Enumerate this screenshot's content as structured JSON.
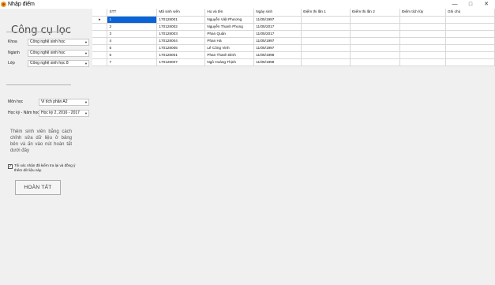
{
  "window": {
    "title": "Nhập điểm",
    "minimize": "—",
    "maximize": "□",
    "close": "✕"
  },
  "sidebar": {
    "title": "Công cụ lọc",
    "khoa": {
      "label": "Khoa",
      "value": "Công nghệ sinh học"
    },
    "nganh": {
      "label": "Ngành",
      "value": "Công nghệ sinh học"
    },
    "lop": {
      "label": "Lớp",
      "value": "Công nghệ sinh học 8"
    },
    "mon_hoc": {
      "label": "Môn học",
      "value": "Vi tích phân A2"
    },
    "hoc_ky": {
      "label": "Học kỳ - Năm học",
      "value": "Học kỳ 2, 2016 - 2017"
    },
    "note": "Thêm sinh viên bằng cách chỉnh sửa dữ liệu ở bảng bên và ấn vào nút hoàn tất dưới đây",
    "confirm_label": "Tôi xác nhận đã kiểm tra lại và đồng ý thêm dữ liệu này.",
    "confirm_checked": "✓",
    "done_button": "HOÀN TẤT"
  },
  "grid": {
    "current_row_marker": "▸",
    "columns": [
      "STT",
      "Mã sinh viên",
      "Họ và tên",
      "Ngày sinh",
      "Điểm thi lần 1",
      "Điểm thi lần 2",
      "Điểm tích lũy",
      "Ghi chú"
    ],
    "rows": [
      [
        "1",
        "170128001",
        "Nguyễn Việt Phương",
        "11/05/1997",
        "",
        "",
        "",
        ""
      ],
      [
        "2",
        "170128002",
        "Nguyễn Thanh Phong",
        "11/05/2017",
        "",
        "",
        "",
        ""
      ],
      [
        "3",
        "170128003",
        "Phan Quân",
        "11/05/2017",
        "",
        "",
        "",
        ""
      ],
      [
        "4",
        "170128004",
        "Phan Hà",
        "11/05/1997",
        "",
        "",
        "",
        ""
      ],
      [
        "5",
        "170128005",
        "Lê Công Vinh",
        "11/05/1997",
        "",
        "",
        "",
        ""
      ],
      [
        "6",
        "170128001",
        "Phan Thanh Bình",
        "11/05/1998",
        "",
        "",
        "",
        ""
      ],
      [
        "7",
        "170128007",
        "Ngô Hoàng Thịnh",
        "11/05/1998",
        "",
        "",
        "",
        ""
      ]
    ],
    "selected_row": 0
  }
}
